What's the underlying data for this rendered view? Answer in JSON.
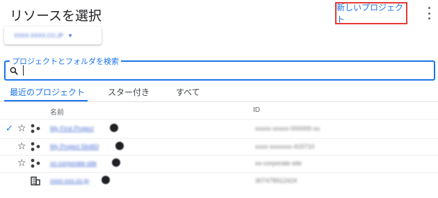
{
  "header": {
    "title": "リソースを選択",
    "new_project_label": "新しいプロジェクト"
  },
  "org_selector": {
    "label": "XXXX-XXXX.CO.JP"
  },
  "search": {
    "label": "プロジェクトとフォルダを検索",
    "value": ""
  },
  "tabs": [
    {
      "label": "最近のプロジェクト",
      "active": true
    },
    {
      "label": "スター付き",
      "active": false
    },
    {
      "label": "すべて",
      "active": false
    }
  ],
  "table": {
    "columns": {
      "name": "名前",
      "id": "ID"
    },
    "rows": [
      {
        "selected": true,
        "starrable": true,
        "type_icon": "project-icon",
        "name": "My First Project",
        "id": "xxxxx-xxxxx-000000-xx"
      },
      {
        "selected": false,
        "starrable": true,
        "type_icon": "project-icon",
        "name": "My Project 56483",
        "id": "xxxx-xxxxxxx-415710"
      },
      {
        "selected": false,
        "starrable": true,
        "type_icon": "project-icon",
        "name": "xx-corporate-site",
        "id": "xx-corporate-site"
      },
      {
        "selected": false,
        "starrable": false,
        "type_icon": "organization-icon",
        "name": "xxxx-xxx.co.jp",
        "id": "307478912424"
      }
    ]
  },
  "colors": {
    "accent": "#1a73e8",
    "highlight_border": "#e53935"
  }
}
